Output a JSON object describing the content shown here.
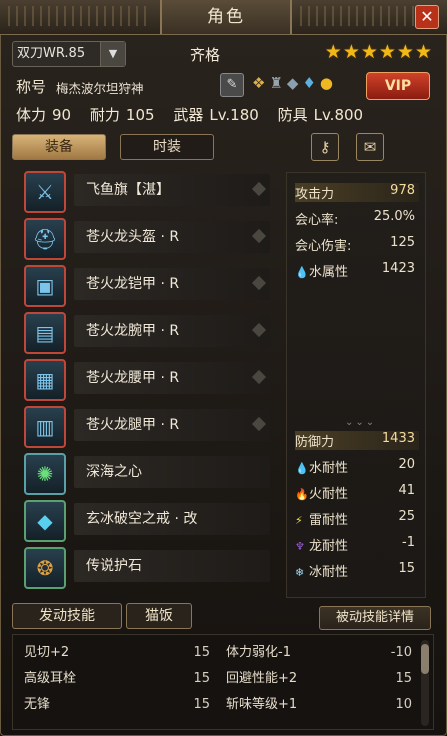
{
  "window": {
    "title": "角色",
    "close": "✕"
  },
  "header": {
    "weapon_select": "双刀WR.85",
    "rank_label": "齐格",
    "stars": "★★★★★★",
    "epithet_label": "称号",
    "epithet": "梅杰波尔坦狩神",
    "vip_label": "VIP"
  },
  "stats": {
    "stamina_label": "体力",
    "stamina": "90",
    "endurance_label": "耐力",
    "endurance": "105",
    "weapon_label": "武器",
    "weapon": "Lv.180",
    "armor_label": "防具",
    "armor": "Lv.800"
  },
  "tabs": {
    "equipment": "装备",
    "fashion": "时装"
  },
  "equipment": [
    {
      "name": "飞鱼旗【湛】",
      "icon": "blades-icon"
    },
    {
      "name": "苍火龙头盔 · R",
      "icon": "helm-icon"
    },
    {
      "name": "苍火龙铠甲 · R",
      "icon": "chest-armor-icon"
    },
    {
      "name": "苍火龙腕甲 · R",
      "icon": "arm-armor-icon"
    },
    {
      "name": "苍火龙腰甲 · R",
      "icon": "waist-armor-icon"
    },
    {
      "name": "苍火龙腿甲 · R",
      "icon": "leg-armor-icon"
    },
    {
      "name": "深海之心",
      "icon": "orb-icon"
    },
    {
      "name": "玄冰破空之戒 · 改",
      "icon": "diamond-ring-icon"
    },
    {
      "name": "传说护石",
      "icon": "charm-icon"
    }
  ],
  "offense": {
    "attack_label": "攻击力",
    "attack": "978",
    "crit_rate_label": "会心率:",
    "crit_rate": "25.0%",
    "crit_dmg_label": "会心伤害:",
    "crit_dmg": "125",
    "element_label": "水属性",
    "element": "1423"
  },
  "defense": {
    "defense_label": "防御力",
    "defense": "1433",
    "water_res_label": "水耐性",
    "water_res": "20",
    "fire_res_label": "火耐性",
    "fire_res": "41",
    "thunder_res_label": "雷耐性",
    "thunder_res": "25",
    "dragon_res_label": "龙耐性",
    "dragon_res": "-1",
    "ice_res_label": "冰耐性",
    "ice_res": "15"
  },
  "skill_tabs": {
    "active": "发动技能",
    "food": "猫饭",
    "passive_detail": "被动技能详情"
  },
  "skills": [
    {
      "name": "见切+2",
      "value": "15"
    },
    {
      "name": "体力弱化-1",
      "value": "-10"
    },
    {
      "name": "高级耳栓",
      "value": "15"
    },
    {
      "name": "回避性能+2",
      "value": "15"
    },
    {
      "name": "无锋",
      "value": "15"
    },
    {
      "name": "斩味等级+1",
      "value": "10"
    }
  ]
}
